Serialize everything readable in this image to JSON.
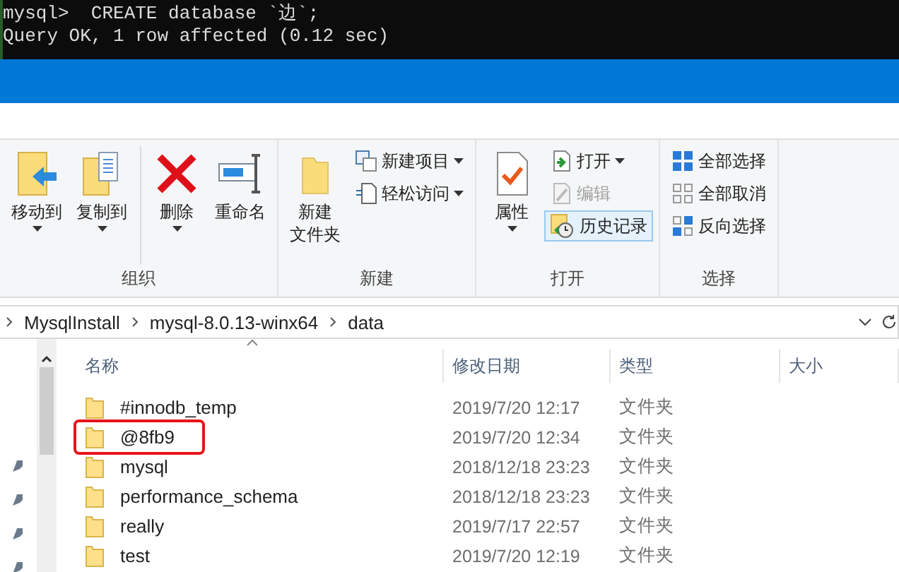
{
  "console": {
    "lines": [
      "mysql>  CREATE database `边`;",
      "Query OK, 1 row affected (0.12 sec)"
    ]
  },
  "ribbon": {
    "groups": [
      {
        "label": "组织",
        "columns": [
          {
            "kind": "large",
            "label": "移动到",
            "dropdown": true,
            "separated": false
          },
          {
            "kind": "large",
            "label": "复制到",
            "dropdown": true,
            "separated": false
          },
          {
            "kind": "large",
            "label": "删除",
            "dropdown": true,
            "separated": true
          },
          {
            "kind": "large",
            "label": "重命名",
            "dropdown": false,
            "separated": false
          }
        ]
      },
      {
        "label": "新建",
        "columns": [
          {
            "kind": "large",
            "label_lines": [
              "新建",
              "文件夹"
            ],
            "dropdown": false,
            "separated": false
          },
          {
            "kind": "stack",
            "items": [
              {
                "label": "新建项目",
                "dropdown": true,
                "disabled": false,
                "selected": false
              },
              {
                "label": "轻松访问",
                "dropdown": true,
                "disabled": false,
                "selected": false
              }
            ]
          }
        ]
      },
      {
        "label": "打开",
        "columns": [
          {
            "kind": "large",
            "label": "属性",
            "dropdown": true,
            "separated": false
          },
          {
            "kind": "stack",
            "items": [
              {
                "label": "打开",
                "dropdown": true,
                "disabled": false,
                "selected": false
              },
              {
                "label": "编辑",
                "dropdown": false,
                "disabled": true,
                "selected": false
              },
              {
                "label": "历史记录",
                "dropdown": false,
                "disabled": false,
                "selected": true
              }
            ]
          }
        ]
      },
      {
        "label": "选择",
        "columns": [
          {
            "kind": "stack",
            "items": [
              {
                "label": "全部选择",
                "dropdown": false,
                "disabled": false,
                "selected": false
              },
              {
                "label": "全部取消",
                "dropdown": false,
                "disabled": false,
                "selected": false
              },
              {
                "label": "反向选择",
                "dropdown": false,
                "disabled": false,
                "selected": false
              }
            ]
          }
        ]
      }
    ]
  },
  "address_bar": {
    "path": [
      "MysqlInstall",
      "mysql-8.0.13-winx64",
      "data"
    ]
  },
  "file_list": {
    "columns": [
      "名称",
      "修改日期",
      "类型",
      "大小"
    ],
    "rows": [
      {
        "name": "#innodb_temp",
        "modified": "2019/7/20 12:17",
        "type": "文件夹",
        "highlighted": false
      },
      {
        "name": "@8fb9",
        "modified": "2019/7/20 12:34",
        "type": "文件夹",
        "highlighted": true
      },
      {
        "name": "mysql",
        "modified": "2018/12/18 23:23",
        "type": "文件夹",
        "highlighted": false
      },
      {
        "name": "performance_schema",
        "modified": "2018/12/18 23:23",
        "type": "文件夹",
        "highlighted": false
      },
      {
        "name": "really",
        "modified": "2019/7/17 22:57",
        "type": "文件夹",
        "highlighted": false
      },
      {
        "name": "test",
        "modified": "2019/7/20 12:19",
        "type": "文件夹",
        "highlighted": false
      }
    ]
  }
}
